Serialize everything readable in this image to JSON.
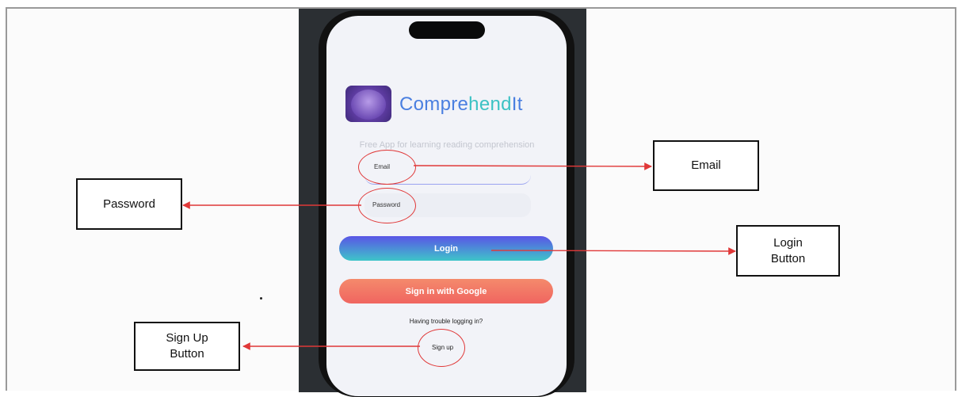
{
  "app": {
    "name_part1": "Compre",
    "name_part2": "hend",
    "name_part3": "It",
    "tagline": "Free App for learning reading comprehension",
    "logo_icon": "comprehendit-logo-icon"
  },
  "form": {
    "email_label": "Email",
    "password_label": "Password",
    "login_label": "Login",
    "google_label": "Sign in with Google",
    "trouble_text": "Having trouble logging in?",
    "signup_label": "Sign up"
  },
  "callouts": {
    "email": "Email",
    "password": "Password",
    "login": "Login\nButton",
    "signup": "Sign Up\nButton"
  },
  "colors": {
    "annotation": "#e03838",
    "brand_blue": "#4a7fe0",
    "brand_teal": "#3cc2c4"
  }
}
